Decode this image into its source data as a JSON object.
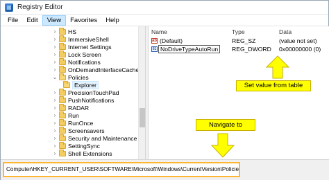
{
  "window": {
    "title": "Registry Editor"
  },
  "menu": [
    "File",
    "Edit",
    "View",
    "Favorites",
    "Help"
  ],
  "tree": [
    {
      "label": "HS",
      "indent": 0
    },
    {
      "label": "ImmersiveShell",
      "indent": 0
    },
    {
      "label": "Internet Settings",
      "indent": 0
    },
    {
      "label": "Lock Screen",
      "indent": 0
    },
    {
      "label": "Notifications",
      "indent": 0
    },
    {
      "label": "OnDemandInterfaceCache",
      "indent": 0
    },
    {
      "label": "Policies",
      "indent": 0
    },
    {
      "label": "Explorer",
      "indent": 1
    },
    {
      "label": "PrecisionTouchPad",
      "indent": 0
    },
    {
      "label": "PushNotifications",
      "indent": 0
    },
    {
      "label": "RADAR",
      "indent": 0
    },
    {
      "label": "Run",
      "indent": 0
    },
    {
      "label": "RunOnce",
      "indent": 0
    },
    {
      "label": "Screensavers",
      "indent": 0
    },
    {
      "label": "Security and Maintenance",
      "indent": 0
    },
    {
      "label": "SettingSync",
      "indent": 0
    },
    {
      "label": "Shell Extensions",
      "indent": 0
    }
  ],
  "list": {
    "headers": {
      "name": "Name",
      "type": "Type",
      "data": "Data"
    },
    "rows": [
      {
        "name": "(Default)",
        "type": "REG_SZ",
        "data": "(value not set)",
        "icon": "string-value-icon"
      },
      {
        "name": "NoDriveTypeAutoRun",
        "type": "REG_DWORD",
        "data": "0x00000000 (0)",
        "icon": "binary-value-icon"
      }
    ]
  },
  "status": {
    "path": "Computer\\HKEY_CURRENT_USER\\SOFTWARE\\Microsoft\\Windows\\CurrentVersion\\Policies\\Explorer"
  },
  "annotations": {
    "set_value": "Set value from table",
    "navigate": "Navigate to"
  },
  "colors": {
    "highlight": "#ffff00",
    "outline": "#ffb52e"
  }
}
